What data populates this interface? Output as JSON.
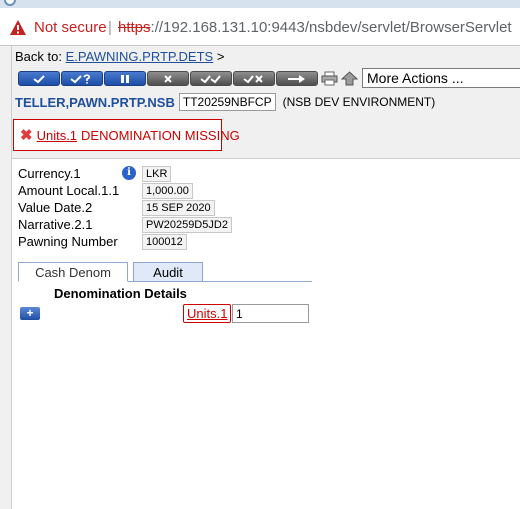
{
  "browser": {
    "security_label": "Not secure",
    "separator": "|",
    "url_scheme": "https",
    "url_rest": "://192.168.131.10:9443/nsbdev/servlet/BrowserServlet"
  },
  "nav": {
    "back_label": "Back to:",
    "back_link": "E.PAWNING.PRTP.DETS",
    "back_suffix": ">"
  },
  "toolbar": {
    "more_actions": "More Actions ..."
  },
  "header": {
    "version": "TELLER,PAWN.PRTP.NSB",
    "transaction_id": "TT20259NBFCP",
    "environment": "(NSB DEV ENVIRONMENT)"
  },
  "error": {
    "field": "Units.1",
    "message": "DENOMINATION MISSING"
  },
  "fields": [
    {
      "label": "Currency.1",
      "value": "LKR"
    },
    {
      "label": "Amount Local.1.1",
      "value": "1,000.00"
    },
    {
      "label": "Value Date.2",
      "value": "15 SEP 2020"
    },
    {
      "label": "Narrative.2.1",
      "value": "PW20259D5JD2"
    },
    {
      "label": "Pawning Number",
      "value": "100012"
    }
  ],
  "tabs": [
    {
      "label": "Cash Denom"
    },
    {
      "label": "Audit"
    }
  ],
  "denomination": {
    "title": "Denomination Details",
    "units_label": "Units.1",
    "units_value": "1"
  }
}
